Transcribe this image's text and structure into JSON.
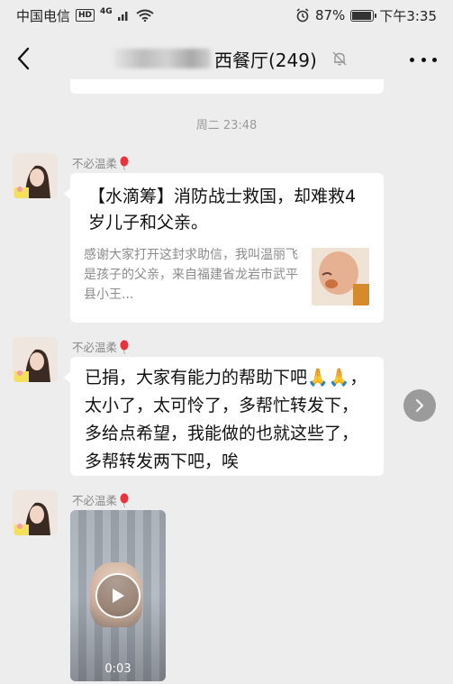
{
  "status_bar": {
    "carrier": "中国电信",
    "hd": "HD",
    "network": "4G",
    "battery_percent": "87%",
    "battery_level": 0.87,
    "time": "下午3:35"
  },
  "header": {
    "title": "西餐厅(249)",
    "back_icon": "chevron-left-icon",
    "mute_icon": "bell-off-icon",
    "more_icon": "more-dots-icon"
  },
  "divider_time": "周二 23:48",
  "messages": [
    {
      "sender": "不必温柔",
      "type": "card",
      "title": "【水滴筹】消防战士救国，却难救4岁儿子和父亲。",
      "description": "感谢大家打开这封求助信，我叫温丽飞是孩子的父亲，来自福建省龙岩市武平县小王..."
    },
    {
      "sender": "不必温柔",
      "type": "text",
      "text": "已捐，大家有能力的帮助下吧🙏🙏，太小了，太可怜了，多帮忙转发下，多给点希望，我能做的也就这些了，多帮转发两下吧，唉"
    },
    {
      "sender": "不必温柔",
      "type": "video",
      "duration": "0:03"
    }
  ],
  "colors": {
    "background": "#ededed",
    "bubble": "#ffffff",
    "nickname": "#8a8a8a",
    "forward_button": "#9b9b9b"
  }
}
